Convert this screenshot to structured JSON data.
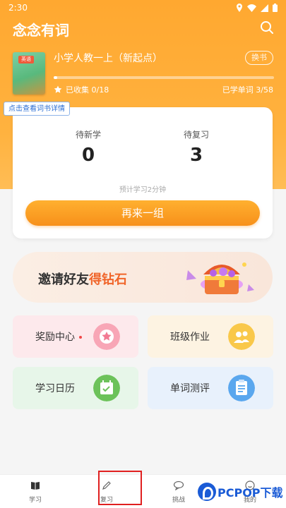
{
  "status": {
    "time": "2:30"
  },
  "header": {
    "title": "念念有词"
  },
  "book": {
    "cover_tag": "英语",
    "name": "小学人教一上（新起点）",
    "change_label": "换书",
    "progress": 0.017,
    "collected": "已收集 0/18",
    "learned": "已学单词 3/58",
    "tooltip": "点击查看词书详情"
  },
  "study": {
    "new_label": "待新学",
    "new_value": "0",
    "review_label": "待复习",
    "review_value": "3",
    "estimate": "预计学习2分钟",
    "again_label": "再来一组"
  },
  "invite": {
    "prefix": "邀请好友",
    "highlight": "得钻石"
  },
  "tiles": {
    "rewards": "奖励中心",
    "homework": "班级作业",
    "calendar": "学习日历",
    "test": "单词测评"
  },
  "nav": {
    "study": "学习",
    "review": "复习",
    "challenge": "挑战",
    "mine": "我的"
  },
  "watermark": {
    "text": "PCPOP下载"
  },
  "colors": {
    "accent": "#ffa830",
    "button": "#f7901a",
    "highlight": "#f0652a"
  }
}
